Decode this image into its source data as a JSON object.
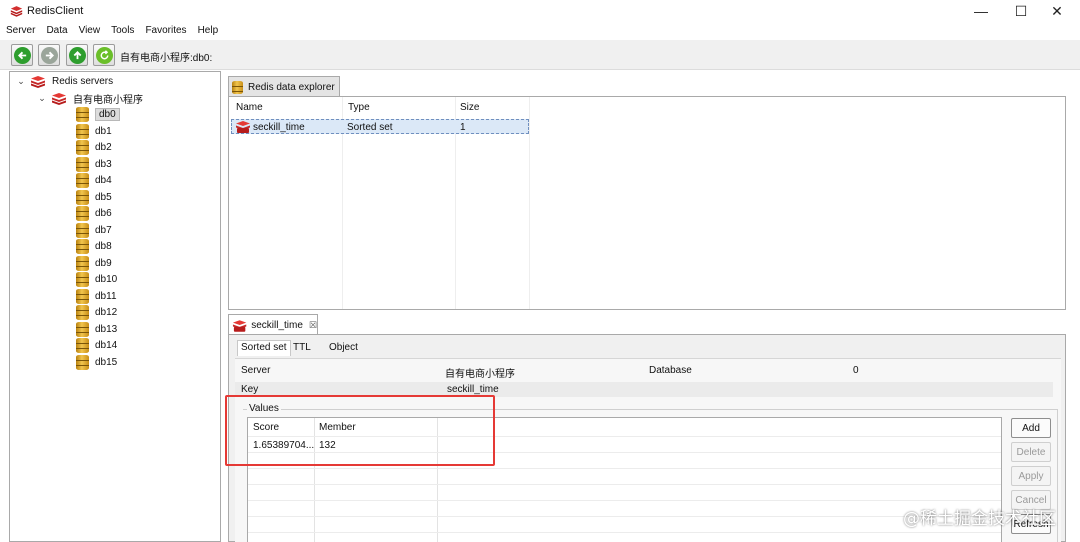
{
  "window": {
    "title": "RedisClient",
    "minimize_glyph": "—",
    "maximize_glyph": "☐",
    "close_glyph": "✕"
  },
  "menu": [
    "Server",
    "Data",
    "View",
    "Tools",
    "Favorites",
    "Help"
  ],
  "toolbar": {
    "buttons": [
      {
        "name": "back",
        "icon": "arrow-left-icon",
        "color": "#2e9e2e"
      },
      {
        "name": "forward",
        "icon": "arrow-right-icon",
        "color": "#9aa59a"
      },
      {
        "name": "up",
        "icon": "arrow-up-icon",
        "color": "#2e9e2e"
      },
      {
        "name": "refresh",
        "icon": "refresh-icon",
        "color": "#6bbf2a"
      }
    ],
    "path": "自有电商小程序:db0:"
  },
  "tree": {
    "root_label": "Redis servers",
    "server_label": "自有电商小程序",
    "databases": [
      "db0",
      "db1",
      "db2",
      "db3",
      "db4",
      "db5",
      "db6",
      "db7",
      "db8",
      "db9",
      "db10",
      "db11",
      "db12",
      "db13",
      "db14",
      "db15"
    ],
    "selected": "db0"
  },
  "explorer": {
    "tab_label": "Redis data explorer",
    "columns": {
      "name": "Name",
      "type": "Type",
      "size": "Size"
    },
    "rows": [
      {
        "name": "seckill_time",
        "type": "Sorted set",
        "size": "1",
        "icon": "zset-icon"
      }
    ]
  },
  "detail": {
    "tab_label": "seckill_time",
    "tab_close": "☒",
    "subtabs": [
      "Sorted set",
      "TTL",
      "Object"
    ],
    "server_label": "Server",
    "server_value": "自有电商小程序",
    "database_label": "Database",
    "database_value": "0",
    "key_label": "Key",
    "key_value": "seckill_time",
    "values_label": "Values",
    "values_columns": {
      "score": "Score",
      "member": "Member"
    },
    "values_rows": [
      {
        "score": "1.65389704...",
        "member": "132"
      }
    ],
    "buttons": {
      "add": "Add",
      "delete": "Delete",
      "apply": "Apply",
      "cancel": "Cancel",
      "refresh": "Refresh"
    }
  },
  "watermark": "@稀土掘金技术社区",
  "colors": {
    "accent_red": "#e53935",
    "selection_blue": "#dbe8f7",
    "redis_red": "#c62828",
    "db_gold": "#e7b43a"
  }
}
